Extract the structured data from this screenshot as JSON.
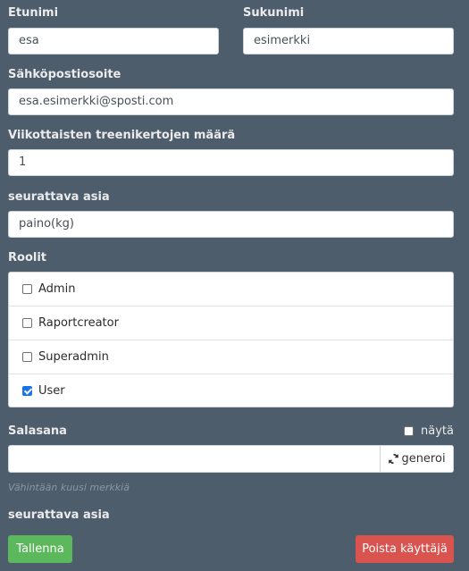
{
  "form": {
    "first_name": {
      "label": "Etunimi",
      "value": "esa"
    },
    "last_name": {
      "label": "Sukunimi",
      "value": "esimerkki"
    },
    "email": {
      "label": "Sähköpostiosoite",
      "value": "esa.esimerkki@sposti.com"
    },
    "weekly_trainings": {
      "label": "Viikottaisten treenikertojen määrä",
      "value": "1"
    },
    "tracked_item": {
      "label": "seurattava asia",
      "value": "paino(kg)"
    },
    "roles": {
      "label": "Roolit",
      "items": [
        {
          "label": "Admin",
          "checked": false
        },
        {
          "label": "Raportcreator",
          "checked": false
        },
        {
          "label": "Superadmin",
          "checked": false
        },
        {
          "label": "User",
          "checked": true
        }
      ]
    },
    "password": {
      "label": "Salasana",
      "value": "",
      "show_label": "näytä",
      "show_checked": false,
      "generate_label": "generoi",
      "generate_icon": "refresh-icon",
      "hint": "Vähintään kuusi merkkiä"
    },
    "tracked_item_footer_label": "seurattava asia"
  },
  "actions": {
    "save_label": "Tallenna",
    "delete_label": "Poista käyttäjä"
  },
  "colors": {
    "background": "#4e5d6c",
    "save": "#5cb85c",
    "delete": "#d9534f",
    "checkbox_checked": "#1a73e8"
  }
}
